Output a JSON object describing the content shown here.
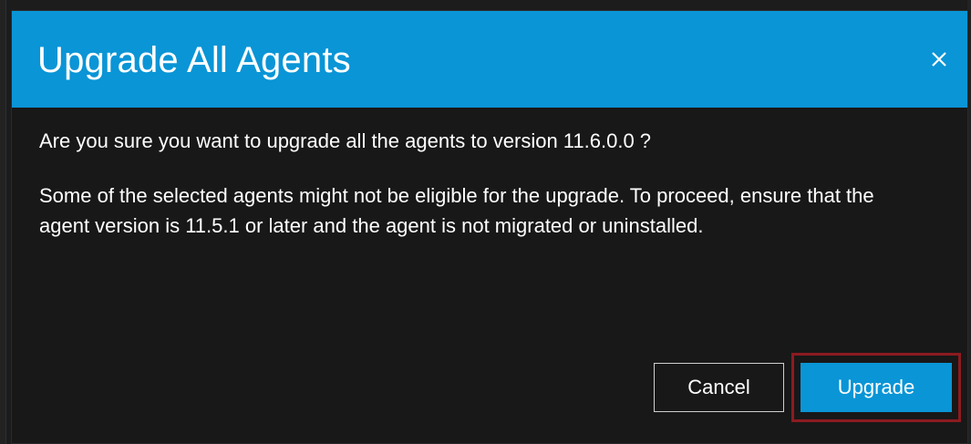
{
  "dialog": {
    "title": "Upgrade All Agents",
    "close_icon": "close-icon",
    "question": "Are you sure you want to upgrade all the agents to version 11.6.0.0 ?",
    "note": "Some of the selected agents might not be eligible for the upgrade. To proceed, ensure that the agent version is 11.5.1 or later and the agent is not migrated or uninstalled.",
    "buttons": {
      "cancel_label": "Cancel",
      "upgrade_label": "Upgrade"
    }
  },
  "colors": {
    "header_bg": "#0a95d6",
    "body_bg": "#181818",
    "primary_button": "#0a95d6",
    "highlight_frame": "#8c1b20",
    "text": "#ffffff"
  }
}
